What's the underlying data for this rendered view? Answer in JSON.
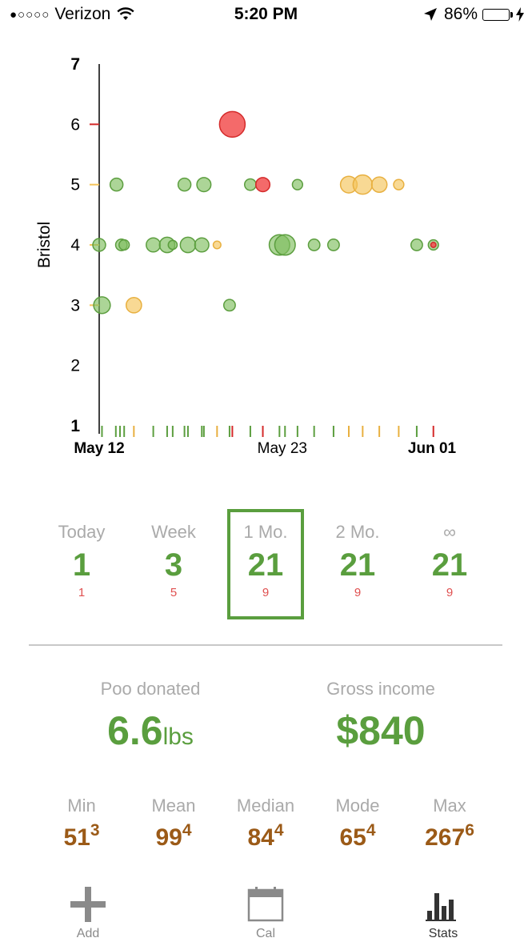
{
  "status_bar": {
    "signal_dots": "●○○○○",
    "carrier": "Verizon",
    "time": "5:20 PM",
    "battery_percent": "86%",
    "battery_level": 0.86
  },
  "chart_data": {
    "type": "scatter",
    "ylabel": "Bristol",
    "ylim": [
      1,
      7
    ],
    "yticks": [
      "1",
      "2",
      "3",
      "4",
      "5",
      "6",
      "7"
    ],
    "x_tick_labels": [
      {
        "date": "2016-05-12",
        "label": "May 12",
        "bold": true
      },
      {
        "date": "2016-05-23",
        "label": "May 23",
        "bold": false
      },
      {
        "date": "2016-06-01",
        "label": "Jun 01",
        "bold": true
      }
    ],
    "xlim": [
      "2016-05-12",
      "2016-06-01"
    ],
    "colors": {
      "normal": "#7fbf5f",
      "warning": "#f5c45a",
      "alert": "#f25050"
    },
    "points": [
      {
        "x": "2016-05-12 00:00",
        "y": 4,
        "size": 1.0,
        "status": "normal"
      },
      {
        "x": "2016-05-12 04:00",
        "y": 3,
        "size": 1.3,
        "status": "normal"
      },
      {
        "x": "2016-05-13 01:00",
        "y": 5,
        "size": 1.0,
        "status": "normal"
      },
      {
        "x": "2016-05-13 08:00",
        "y": 4,
        "size": 0.9,
        "status": "normal"
      },
      {
        "x": "2016-05-13 12:00",
        "y": 4,
        "size": 0.8,
        "status": "normal"
      },
      {
        "x": "2016-05-14 02:00",
        "y": 3,
        "size": 1.2,
        "status": "warning"
      },
      {
        "x": "2016-05-15 06:00",
        "y": 4,
        "size": 1.1,
        "status": "normal"
      },
      {
        "x": "2016-05-16 02:00",
        "y": 4,
        "size": 1.2,
        "status": "normal"
      },
      {
        "x": "2016-05-16 10:00",
        "y": 4,
        "size": 0.7,
        "status": "normal"
      },
      {
        "x": "2016-05-17 03:00",
        "y": 5,
        "size": 1.0,
        "status": "normal"
      },
      {
        "x": "2016-05-17 08:00",
        "y": 4,
        "size": 1.2,
        "status": "normal"
      },
      {
        "x": "2016-05-18 04:00",
        "y": 4,
        "size": 1.1,
        "status": "normal"
      },
      {
        "x": "2016-05-18 07:00",
        "y": 5,
        "size": 1.1,
        "status": "normal"
      },
      {
        "x": "2016-05-19 02:00",
        "y": 4,
        "size": 0.6,
        "status": "warning"
      },
      {
        "x": "2016-05-19 20:00",
        "y": 3,
        "size": 0.9,
        "status": "normal"
      },
      {
        "x": "2016-05-20 00:00",
        "y": 6,
        "size": 2.0,
        "status": "alert"
      },
      {
        "x": "2016-05-21 02:00",
        "y": 5,
        "size": 0.9,
        "status": "normal"
      },
      {
        "x": "2016-05-21 20:00",
        "y": 5,
        "size": 1.1,
        "status": "alert"
      },
      {
        "x": "2016-05-22 20:00",
        "y": 4,
        "size": 1.6,
        "status": "normal"
      },
      {
        "x": "2016-05-23 04:00",
        "y": 4,
        "size": 1.6,
        "status": "normal"
      },
      {
        "x": "2016-05-23 22:00",
        "y": 5,
        "size": 0.8,
        "status": "normal"
      },
      {
        "x": "2016-05-24 22:00",
        "y": 4,
        "size": 0.9,
        "status": "normal"
      },
      {
        "x": "2016-05-26 02:00",
        "y": 4,
        "size": 0.9,
        "status": "normal"
      },
      {
        "x": "2016-05-27 00:00",
        "y": 5,
        "size": 1.3,
        "status": "warning"
      },
      {
        "x": "2016-05-27 20:00",
        "y": 5,
        "size": 1.5,
        "status": "warning"
      },
      {
        "x": "2016-05-28 20:00",
        "y": 5,
        "size": 1.2,
        "status": "warning"
      },
      {
        "x": "2016-05-30 00:00",
        "y": 5,
        "size": 0.8,
        "status": "warning"
      },
      {
        "x": "2016-05-31 02:00",
        "y": 4,
        "size": 0.9,
        "status": "normal"
      },
      {
        "x": "2016-06-01 02:00",
        "y": 4,
        "size": 0.8,
        "status": "normal"
      },
      {
        "x": "2016-06-01 02:00",
        "y": 4,
        "size": 0.4,
        "status": "alert"
      }
    ],
    "rug_ticks": [
      {
        "x": "2016-05-12 04:00",
        "status": "normal"
      },
      {
        "x": "2016-05-13 00:00",
        "status": "normal"
      },
      {
        "x": "2016-05-13 06:00",
        "status": "normal"
      },
      {
        "x": "2016-05-13 12:00",
        "status": "normal"
      },
      {
        "x": "2016-05-14 02:00",
        "status": "warning"
      },
      {
        "x": "2016-05-15 06:00",
        "status": "normal"
      },
      {
        "x": "2016-05-16 02:00",
        "status": "normal"
      },
      {
        "x": "2016-05-16 10:00",
        "status": "normal"
      },
      {
        "x": "2016-05-17 03:00",
        "status": "normal"
      },
      {
        "x": "2016-05-17 08:00",
        "status": "normal"
      },
      {
        "x": "2016-05-18 04:00",
        "status": "normal"
      },
      {
        "x": "2016-05-18 07:00",
        "status": "normal"
      },
      {
        "x": "2016-05-19 02:00",
        "status": "warning"
      },
      {
        "x": "2016-05-19 20:00",
        "status": "normal"
      },
      {
        "x": "2016-05-20 00:00",
        "status": "alert"
      },
      {
        "x": "2016-05-21 02:00",
        "status": "normal"
      },
      {
        "x": "2016-05-21 20:00",
        "status": "alert"
      },
      {
        "x": "2016-05-22 20:00",
        "status": "normal"
      },
      {
        "x": "2016-05-23 04:00",
        "status": "normal"
      },
      {
        "x": "2016-05-23 22:00",
        "status": "normal"
      },
      {
        "x": "2016-05-24 22:00",
        "status": "normal"
      },
      {
        "x": "2016-05-26 02:00",
        "status": "normal"
      },
      {
        "x": "2016-05-27 00:00",
        "status": "warning"
      },
      {
        "x": "2016-05-27 20:00",
        "status": "warning"
      },
      {
        "x": "2016-05-28 20:00",
        "status": "warning"
      },
      {
        "x": "2016-05-30 00:00",
        "status": "warning"
      },
      {
        "x": "2016-05-31 02:00",
        "status": "normal"
      },
      {
        "x": "2016-06-01 02:00",
        "status": "alert"
      }
    ]
  },
  "ranges": [
    {
      "label": "Today",
      "count": "1",
      "sub": "1",
      "selected": false
    },
    {
      "label": "Week",
      "count": "3",
      "sub": "5",
      "selected": false
    },
    {
      "label": "1 Mo.",
      "count": "21",
      "sub": "9",
      "selected": true
    },
    {
      "label": "2 Mo.",
      "count": "21",
      "sub": "9",
      "selected": false
    },
    {
      "label": "∞",
      "count": "21",
      "sub": "9",
      "selected": false
    }
  ],
  "totals": {
    "donated_label": "Poo donated",
    "donated_value": "6.6",
    "donated_unit": "lbs",
    "income_label": "Gross income",
    "income_value": "$840"
  },
  "stats": [
    {
      "label": "Min",
      "value": "51",
      "sup": "3"
    },
    {
      "label": "Mean",
      "value": "99",
      "sup": "4"
    },
    {
      "label": "Median",
      "value": "84",
      "sup": "4"
    },
    {
      "label": "Mode",
      "value": "65",
      "sup": "4"
    },
    {
      "label": "Max",
      "value": "267",
      "sup": "6"
    }
  ],
  "tabs": [
    {
      "label": "Add",
      "icon": "plus-icon",
      "active": false
    },
    {
      "label": "Cal",
      "icon": "calendar-icon",
      "active": false
    },
    {
      "label": "Stats",
      "icon": "bar-chart-icon",
      "active": true
    }
  ]
}
